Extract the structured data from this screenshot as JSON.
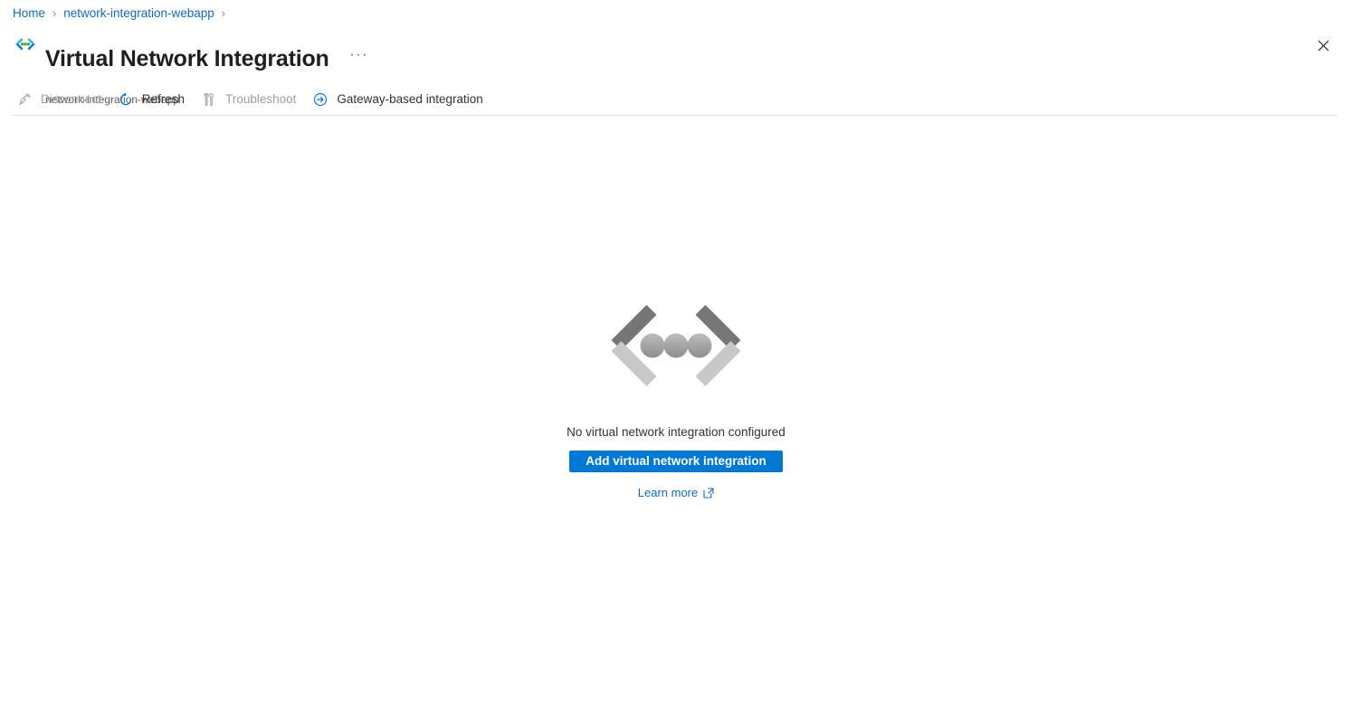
{
  "breadcrumb": {
    "items": [
      {
        "label": "Home"
      },
      {
        "label": "network-integration-webapp"
      }
    ],
    "separator": "›"
  },
  "header": {
    "logo_icon": "vnet-integration-icon",
    "title": "Virtual Network Integration",
    "subtitle": "network-integration-webapp",
    "more_label": "···",
    "more_icon": "ellipsis-icon",
    "close_icon": "close-icon"
  },
  "command_bar": {
    "commands": [
      {
        "label": "Disconnect",
        "icon": "disconnect-plug-icon",
        "disabled": true
      },
      {
        "label": "Refresh",
        "icon": "refresh-icon",
        "disabled": false
      },
      {
        "label": "Troubleshoot",
        "icon": "troubleshoot-tools-icon",
        "disabled": true
      },
      {
        "label": "Gateway-based integration",
        "icon": "arrow-circle-right-icon",
        "disabled": false
      }
    ]
  },
  "empty_state": {
    "illustration_icon": "vnet-integration-grayscale-illustration",
    "message": "No virtual network integration configured",
    "primary_button_label": "Add virtual network integration",
    "learn_more_label": "Learn more",
    "learn_more_icon": "external-link-icon"
  },
  "colors": {
    "accent": "#0078d4",
    "link": "#0f6cbd",
    "text_primary": "#201f1e",
    "text_secondary": "#605e5c",
    "disabled": "#a19f9d",
    "divider": "#e1dfdd",
    "background": "#ffffff"
  }
}
